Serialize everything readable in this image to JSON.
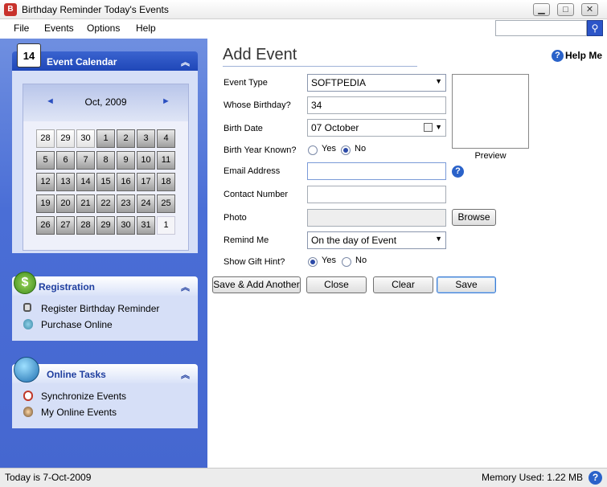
{
  "window": {
    "title": "Birthday Reminder Today's Events",
    "minimize": "▁",
    "maximize": "□",
    "close": "✕"
  },
  "menu": [
    "File",
    "Events",
    "Options",
    "Help"
  ],
  "search": {
    "icon": "search-icon",
    "button_glyph": "⚲"
  },
  "sidebar": {
    "event_calendar": {
      "title": "Event Calendar",
      "month": "Oct, 2009",
      "prev": "◄",
      "next": "►",
      "collapse": "︽",
      "days": [
        [
          "28",
          "29",
          "30",
          "1",
          "2",
          "3",
          "4"
        ],
        [
          "5",
          "6",
          "7",
          "8",
          "9",
          "10",
          "11"
        ],
        [
          "12",
          "13",
          "14",
          "15",
          "16",
          "17",
          "18"
        ],
        [
          "19",
          "20",
          "21",
          "22",
          "23",
          "24",
          "25"
        ],
        [
          "26",
          "27",
          "28",
          "29",
          "30",
          "31",
          "1"
        ]
      ]
    },
    "registration": {
      "title": "Registration",
      "collapse": "︽",
      "items": [
        "Register Birthday Reminder",
        "Purchase Online"
      ]
    },
    "online_tasks": {
      "title": "Online Tasks",
      "collapse": "︽",
      "items": [
        "Synchronize Events",
        "My Online Events"
      ]
    }
  },
  "form": {
    "title": "Add Event",
    "help": "Help Me",
    "help_glyph": "?",
    "event_type": {
      "label": "Event Type",
      "value": "SOFTPEDIA"
    },
    "whose_birthday": {
      "label": "Whose Birthday?",
      "value": "34"
    },
    "birth_date": {
      "label": "Birth Date",
      "value": "07  October"
    },
    "birth_year_known": {
      "label": "Birth Year Known?",
      "yes": "Yes",
      "no": "No",
      "selected": "No"
    },
    "email": {
      "label": "Email Address",
      "value": ""
    },
    "contact": {
      "label": "Contact Number",
      "value": ""
    },
    "photo": {
      "label": "Photo",
      "value": "",
      "browse": "Browse"
    },
    "remind_me": {
      "label": "Remind Me",
      "value": "On the day of Event"
    },
    "gift_hint": {
      "label": "Show Gift Hint?",
      "yes": "Yes",
      "no": "No",
      "selected": "Yes"
    },
    "preview": "Preview",
    "buttons": {
      "save_add": "Save & Add Another",
      "close": "Close",
      "clear": "Clear",
      "save": "Save"
    }
  },
  "status": {
    "left": "Today is 7-Oct-2009",
    "right": "Memory Used: 1.22 MB",
    "help_glyph": "?"
  },
  "colors": {
    "sidebar": "#4a6ed6",
    "panel_body": "#d6dff7",
    "accent": "#2a62c9"
  }
}
